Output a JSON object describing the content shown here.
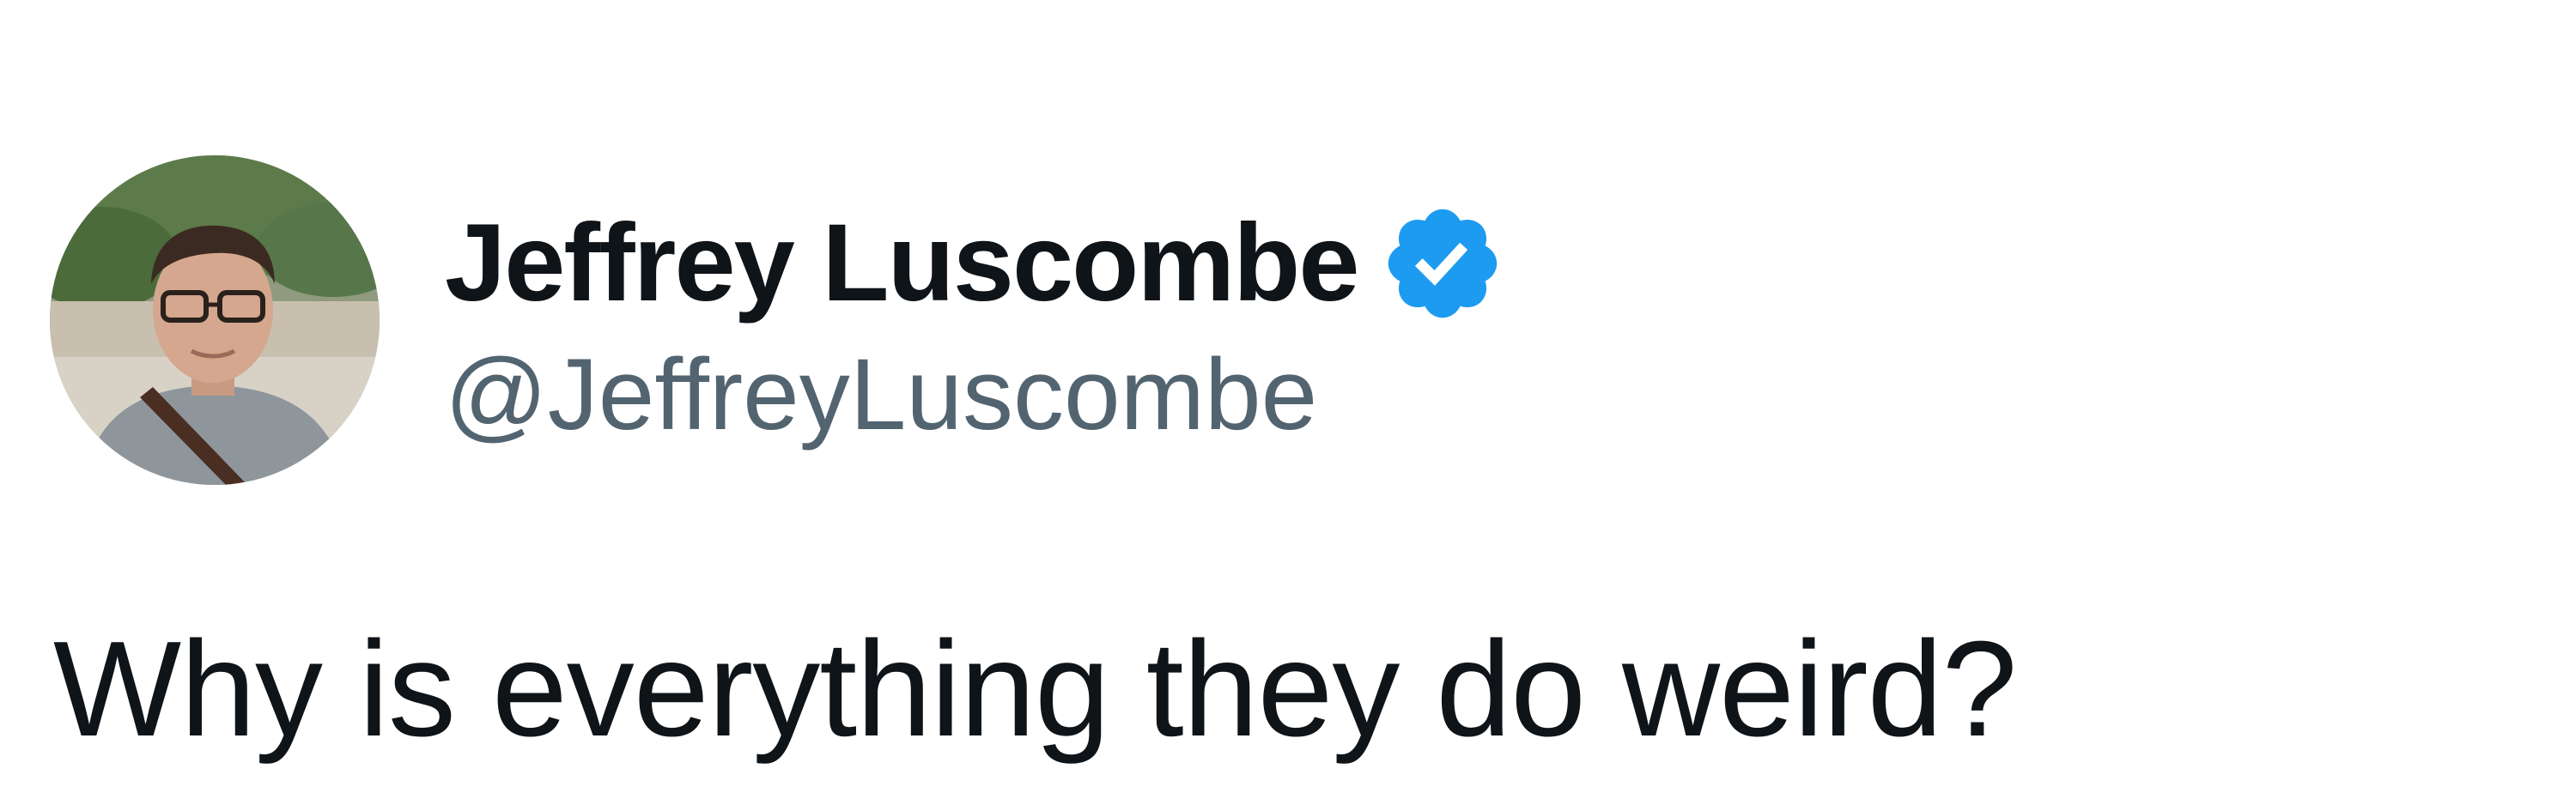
{
  "tweet": {
    "author": {
      "display_name": "Jeffrey Luscombe",
      "handle": "@JeffreyLuscombe",
      "verified": true,
      "avatar_icon": "user-photo-avatar",
      "verified_icon": "verified-badge-icon"
    },
    "text": "Why is everything they do weird?"
  },
  "colors": {
    "text_primary": "#0f1419",
    "text_secondary": "#536471",
    "verified_blue": "#1d9bf0",
    "background": "#ffffff"
  }
}
